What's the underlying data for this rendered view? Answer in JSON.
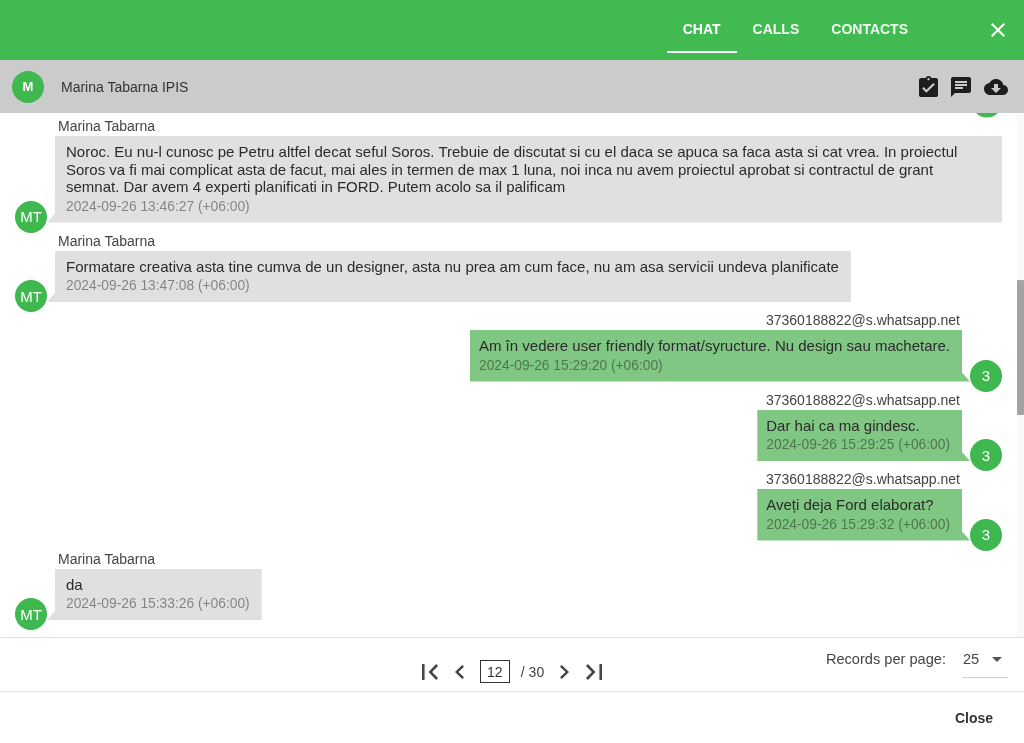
{
  "top_bar": {
    "tabs": [
      {
        "label": "CHAT",
        "selected": true
      },
      {
        "label": "CALLS",
        "selected": false
      },
      {
        "label": "CONTACTS",
        "selected": false
      }
    ]
  },
  "chat_header": {
    "avatar": "M",
    "name": "Marina Tabarna IPIS"
  },
  "messages": [
    {
      "kind": "incoming",
      "sender": "Marina Tabarna",
      "avatar": "MT",
      "text": "Noroc. Eu nu-l cunosc pe Petru altfel decat seful Soros. Trebuie de discutat si cu el daca se apuca sa faca asta si cat vrea. In proiectul Soros va fi mai complicat asta de facut, mai ales in termen de max 1 luna, noi inca nu avem proiectul aprobat si contractul de grant semnat. Dar avem 4 experti planificati in FORD. Putem acolo sa il palificam",
      "time": "2024-09-26 13:46:27 (+06:00)"
    },
    {
      "kind": "incoming",
      "sender": "Marina Tabarna",
      "avatar": "MT",
      "text": "Formatare creativa asta tine cumva de un designer, asta nu prea am cum face, nu am asa servicii undeva planificate",
      "time": "2024-09-26 13:47:08 (+06:00)"
    },
    {
      "kind": "outgoing",
      "sender": "37360188822@s.whatsapp.net",
      "avatar": "3",
      "text": "Am în vedere user friendly format/syructure. Nu design sau machetare.",
      "time": "2024-09-26 15:29:20 (+06:00)"
    },
    {
      "kind": "outgoing",
      "sender": "37360188822@s.whatsapp.net",
      "avatar": "3",
      "text": "Dar hai ca ma gindesc.",
      "time": "2024-09-26 15:29:25 (+06:00)"
    },
    {
      "kind": "outgoing",
      "sender": "37360188822@s.whatsapp.net",
      "avatar": "3",
      "text": "Aveți deja Ford elaborat?",
      "time": "2024-09-26 15:29:32 (+06:00)"
    },
    {
      "kind": "incoming",
      "sender": "Marina Tabarna",
      "avatar": "MT",
      "text": "da",
      "time": "2024-09-26 15:33:26 (+06:00)"
    }
  ],
  "pagination": {
    "page": "12",
    "total": "/ 30",
    "records_label": "Records per page:",
    "records_value": "25"
  },
  "actions": [
    "Close"
  ]
}
